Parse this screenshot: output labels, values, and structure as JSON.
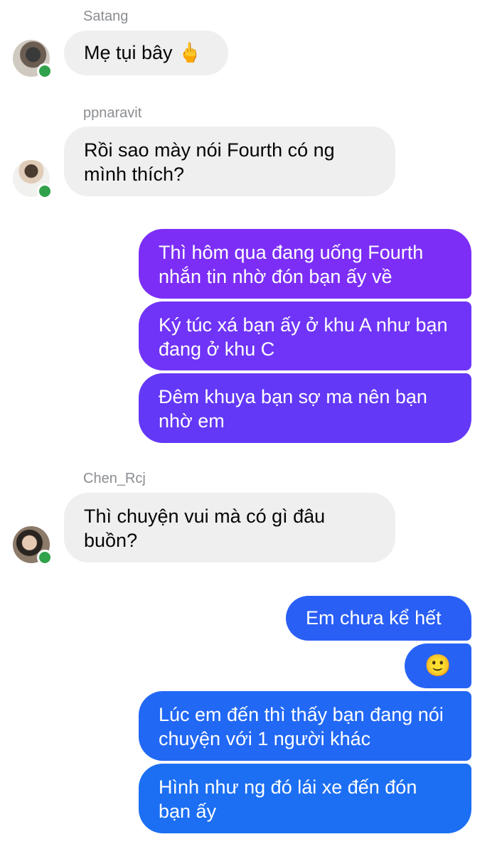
{
  "messages": {
    "m1": {
      "sender": "Satang",
      "text": "Mẹ tụi bây 🖕"
    },
    "m2": {
      "sender": "ppnaravit",
      "text": "Rồi sao mày nói Fourth có ng mình thích?"
    },
    "m3": {
      "text": "Thì hôm qua đang uống Fourth nhắn tin nhờ đón bạn ấy về"
    },
    "m4": {
      "text": "Ký túc xá bạn ấy ở khu A như bạn đang ở khu C"
    },
    "m5": {
      "text": "Đêm khuya bạn sợ ma nên bạn nhờ em"
    },
    "m6": {
      "sender": "Chen_Rcj",
      "text": "Thì chuyện vui mà có gì đâu buồn?"
    },
    "m7": {
      "text": "Em chưa kể hết"
    },
    "m8": {
      "text": "🙂"
    },
    "m9": {
      "text": "Lúc em đến thì thấy bạn đang nói chuyện với 1 người khác"
    },
    "m10": {
      "text": "Hình như ng đó lái xe đến đón bạn ấy"
    }
  },
  "colors": {
    "incoming_bubble": "#efefef",
    "outgoing_purple": "#7a2cf5",
    "outgoing_blue": "#1c6ff3",
    "online_dot": "#31a24c"
  }
}
